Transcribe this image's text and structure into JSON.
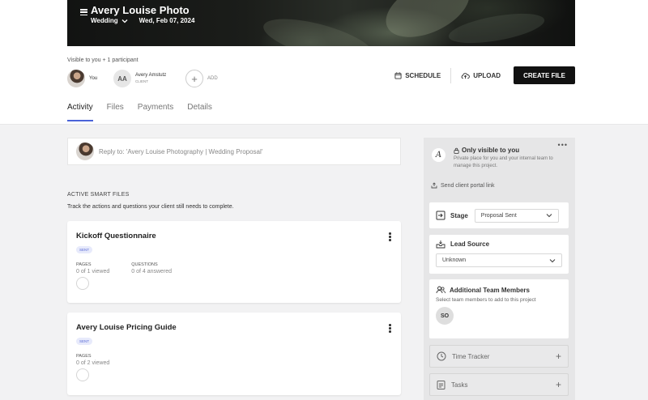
{
  "header": {
    "title": "Avery Louise Photo",
    "project_type": "Wedding",
    "date": "Wed, Feb 07, 2024"
  },
  "participants": {
    "visible_to": "Visible to you + 1 participant",
    "you_label": "You",
    "client_initials": "AA",
    "client_name": "Avery Amstutz",
    "client_role": "CLIENT",
    "add_label": "ADD"
  },
  "actions": {
    "schedule": "SCHEDULE",
    "upload": "UPLOAD",
    "create_file": "CREATE FILE"
  },
  "tabs": [
    {
      "label": "Activity",
      "active": true
    },
    {
      "label": "Files",
      "active": false
    },
    {
      "label": "Payments",
      "active": false
    },
    {
      "label": "Details",
      "active": false
    }
  ],
  "reply": {
    "placeholder": "Reply to: 'Avery Louise Photography | Wedding Proposal'"
  },
  "smart_files": {
    "heading": "ACTIVE SMART FILES",
    "description": "Track the actions and questions your client still needs to complete.",
    "files": [
      {
        "title": "Kickoff Questionnaire",
        "status": "SENT",
        "pages_label": "PAGES",
        "pages_value": "0 of 1 viewed",
        "questions_label": "QUESTIONS",
        "questions_value": "0 of 4 answered"
      },
      {
        "title": "Avery Louise Pricing Guide",
        "status": "SENT",
        "pages_label": "PAGES",
        "pages_value": "0 of 2 viewed"
      }
    ]
  },
  "sidebar": {
    "more": "•••",
    "logo_letter": "A",
    "only_visible": "Only visible to you",
    "private_note": "Private place for you and your internal team to manage this project.",
    "portal_link": "Send client portal link",
    "stage_label": "Stage",
    "stage_value": "Proposal Sent",
    "lead_source_label": "Lead Source",
    "lead_source_value": "Unknown",
    "team_label": "Additional Team Members",
    "team_desc": "Select team members to add to this project",
    "team_member_initials": "SO",
    "time_tracker": "Time Tracker",
    "tasks": "Tasks"
  },
  "colors": {
    "accent": "#4a63d8",
    "badge_bg": "#e7eafb",
    "primary_button": "#111111"
  }
}
